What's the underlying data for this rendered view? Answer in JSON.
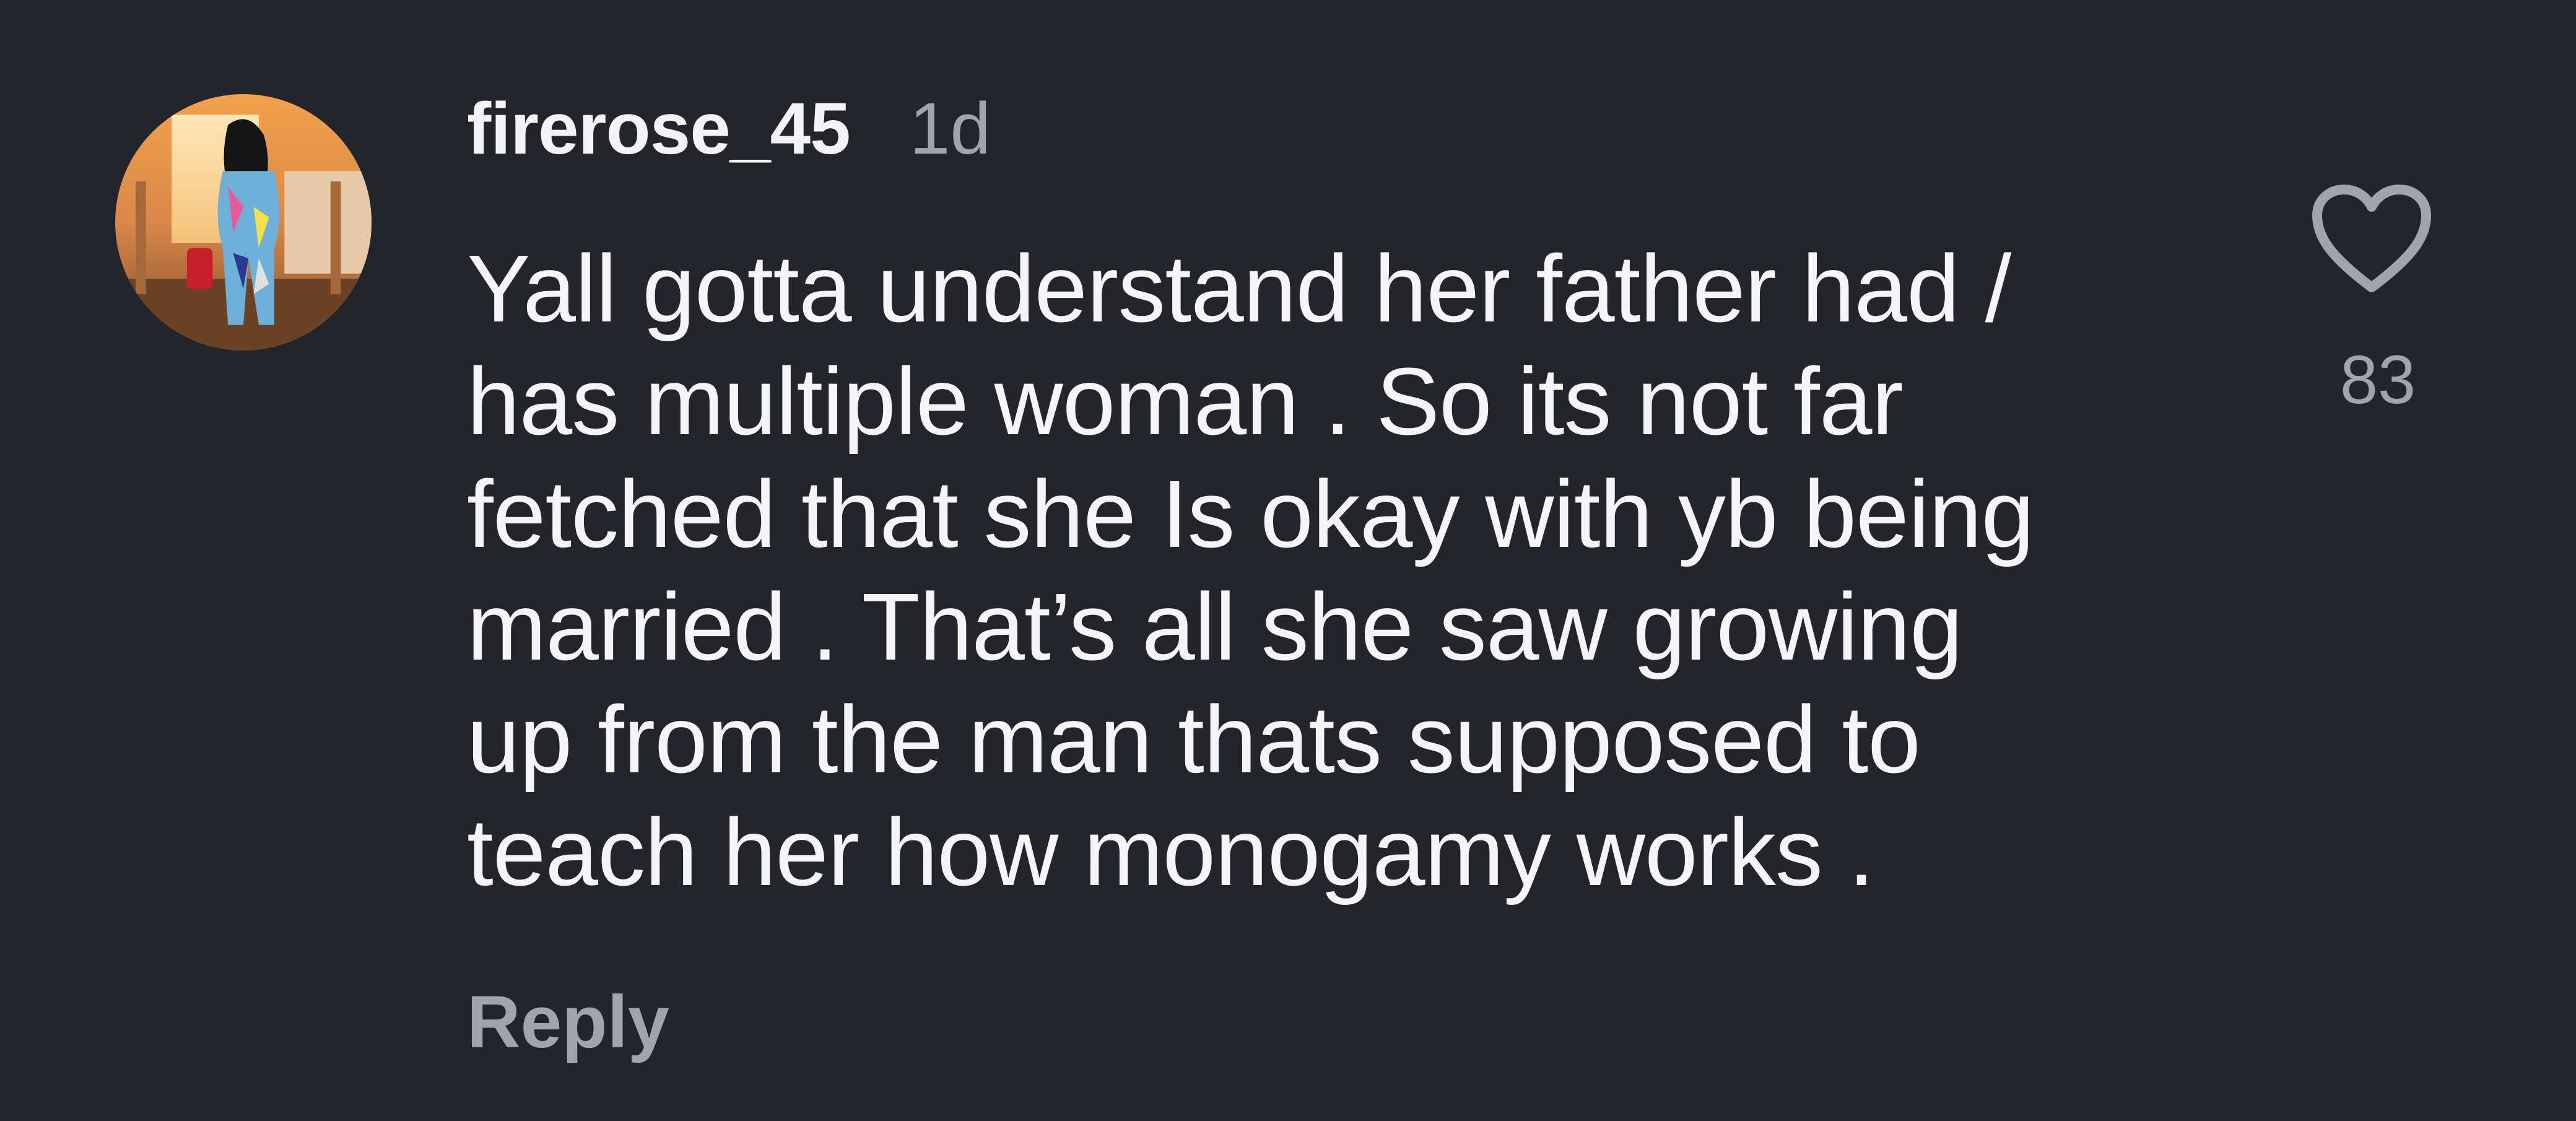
{
  "comment": {
    "username": "firerose_45",
    "timestamp": "1d",
    "lines": [
      "Yall gotta understand her father had /",
      "has multiple woman . So its not far",
      "fetched that she Is okay with yb being",
      "married . That’s all she saw growing",
      "up from the man thats supposed to",
      "teach her how monogamy works ."
    ],
    "reply_label": "Reply",
    "like_count": "83",
    "like_icon": "heart-outline-icon"
  },
  "colors": {
    "background": "#24252a",
    "primary_text": "#f5f5f7",
    "secondary_text": "#a3a4ab"
  }
}
